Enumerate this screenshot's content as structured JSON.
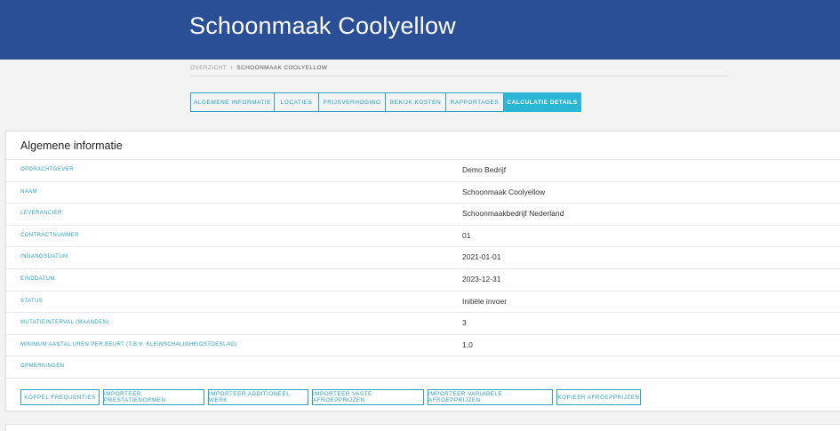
{
  "header": {
    "title": "Schoonmaak Coolyellow"
  },
  "breadcrumb": {
    "parent": "OVERZICHT",
    "separator": "›",
    "current": "SCHOONMAAK COOLYELLOW"
  },
  "tabs": [
    {
      "label": "ALGEMENE INFORMATIE"
    },
    {
      "label": "LOCATIES"
    },
    {
      "label": "PRIJSVERHOGING"
    },
    {
      "label": "BEKIJK KOSTEN"
    },
    {
      "label": "RAPPORTAGES"
    },
    {
      "label": "CALCULATIE DETAILS"
    }
  ],
  "section": {
    "title": "Algemene informatie",
    "rows": [
      {
        "label": "OPDRACHTGEVER",
        "value": "Demo Bedrijf"
      },
      {
        "label": "NAAM",
        "value": "Schoonmaak Coolyellow"
      },
      {
        "label": "LEVERANCIER",
        "value": "Schoonmaakbedrijf Nederland"
      },
      {
        "label": "CONTRACTNUMMER",
        "value": "01"
      },
      {
        "label": "INGANGSDATUM",
        "value": "2021-01-01"
      },
      {
        "label": "EINDDATUM",
        "value": "2023-12-31"
      },
      {
        "label": "STATUS",
        "value": "Initiële invoer"
      },
      {
        "label": "MUTATIEINTERVAL (MAANDEN)",
        "value": "3"
      },
      {
        "label": "MINIMUM AANTAL UREN PER BEURT (T.B.V. KLEINSCHALIGHEIDSTOESLAG)",
        "value": "1,0"
      },
      {
        "label": "OPMERKINGEN",
        "value": ""
      }
    ]
  },
  "actions": [
    {
      "label": "KOPPEL FREQUENTIES"
    },
    {
      "label": "IMPORTEER PRESTATIENORMEN"
    },
    {
      "label": "IMPORTEER ADDITIONEEL WERK"
    },
    {
      "label": "IMPORTEER VASTE AFROEPPRIJZEN"
    },
    {
      "label": "IMPORTEER VARIABELE AFROEPPRIJZEN"
    },
    {
      "label": "KOPIEER AFROEPPRIJZEN"
    }
  ],
  "colors": {
    "header": "#2a4f96",
    "accent": "#29a3c6",
    "active_tab": "#2ab6d4"
  }
}
